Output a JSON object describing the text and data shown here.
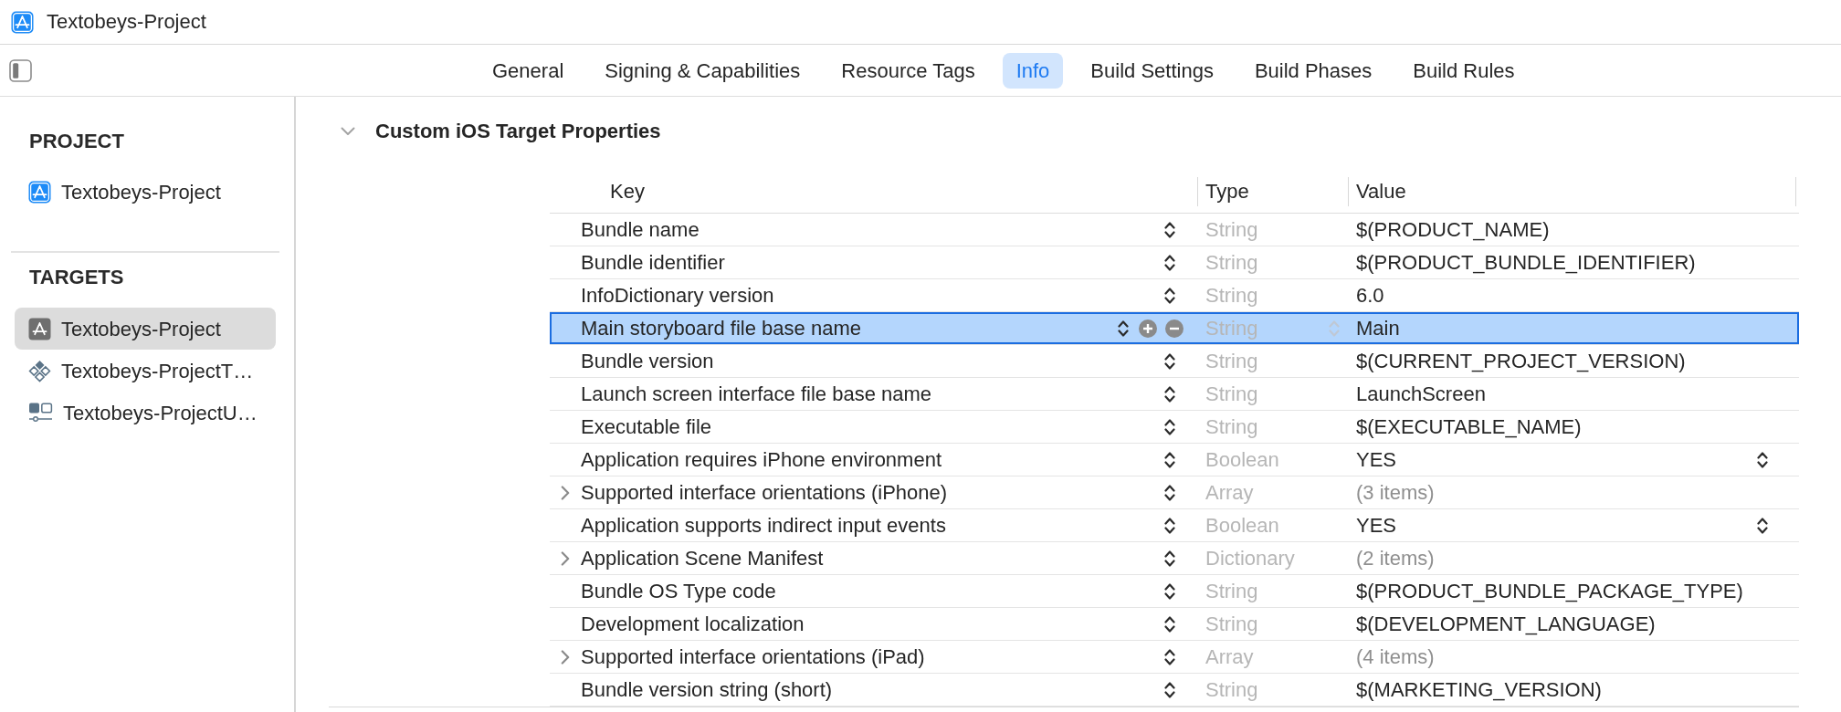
{
  "window": {
    "title": "Textobeys-Project"
  },
  "toolbar": {
    "tabs": [
      {
        "label": "General",
        "selected": false
      },
      {
        "label": "Signing & Capabilities",
        "selected": false
      },
      {
        "label": "Resource Tags",
        "selected": false
      },
      {
        "label": "Info",
        "selected": true
      },
      {
        "label": "Build Settings",
        "selected": false
      },
      {
        "label": "Build Phases",
        "selected": false
      },
      {
        "label": "Build Rules",
        "selected": false
      }
    ]
  },
  "sidebar": {
    "sections": [
      {
        "header": "PROJECT",
        "items": [
          {
            "label": "Textobeys-Project",
            "kind": "project",
            "selected": false
          }
        ]
      },
      {
        "header": "TARGETS",
        "items": [
          {
            "label": "Textobeys-Project",
            "kind": "app",
            "selected": true
          },
          {
            "label": "Textobeys-ProjectT…",
            "kind": "tests",
            "selected": false
          },
          {
            "label": "Textobeys-ProjectU…",
            "kind": "ui-tests",
            "selected": false
          }
        ]
      }
    ]
  },
  "section": {
    "title": "Custom iOS Target Properties",
    "expanded": true
  },
  "table": {
    "columns": [
      "Key",
      "Type",
      "Value"
    ],
    "rows": [
      {
        "key": "Bundle name",
        "type": "String",
        "value": "$(PRODUCT_NAME)",
        "kind": "text",
        "selected": false
      },
      {
        "key": "Bundle identifier",
        "type": "String",
        "value": "$(PRODUCT_BUNDLE_IDENTIFIER)",
        "kind": "text",
        "selected": false
      },
      {
        "key": "InfoDictionary version",
        "type": "String",
        "value": "6.0",
        "kind": "text",
        "selected": false
      },
      {
        "key": "Main storyboard file base name",
        "type": "String",
        "value": "Main",
        "kind": "text",
        "selected": true
      },
      {
        "key": "Bundle version",
        "type": "String",
        "value": "$(CURRENT_PROJECT_VERSION)",
        "kind": "text",
        "selected": false
      },
      {
        "key": "Launch screen interface file base name",
        "type": "String",
        "value": "LaunchScreen",
        "kind": "text",
        "selected": false
      },
      {
        "key": "Executable file",
        "type": "String",
        "value": "$(EXECUTABLE_NAME)",
        "kind": "text",
        "selected": false
      },
      {
        "key": "Application requires iPhone environment",
        "type": "Boolean",
        "value": "YES",
        "kind": "boolean",
        "selected": false
      },
      {
        "key": "Supported interface orientations (iPhone)",
        "type": "Array",
        "value": "(3 items)",
        "kind": "collection",
        "expanded": false,
        "selected": false
      },
      {
        "key": "Application supports indirect input events",
        "type": "Boolean",
        "value": "YES",
        "kind": "boolean",
        "selected": false
      },
      {
        "key": "Application Scene Manifest",
        "type": "Dictionary",
        "value": "(2 items)",
        "kind": "collection",
        "expanded": false,
        "selected": false
      },
      {
        "key": "Bundle OS Type code",
        "type": "String",
        "value": "$(PRODUCT_BUNDLE_PACKAGE_TYPE)",
        "kind": "text",
        "selected": false
      },
      {
        "key": "Development localization",
        "type": "String",
        "value": "$(DEVELOPMENT_LANGUAGE)",
        "kind": "text",
        "selected": false
      },
      {
        "key": "Supported interface orientations (iPad)",
        "type": "Array",
        "value": "(4 items)",
        "kind": "collection",
        "expanded": false,
        "selected": false
      },
      {
        "key": "Bundle version string (short)",
        "type": "String",
        "value": "$(MARKETING_VERSION)",
        "kind": "text",
        "selected": false
      }
    ]
  }
}
